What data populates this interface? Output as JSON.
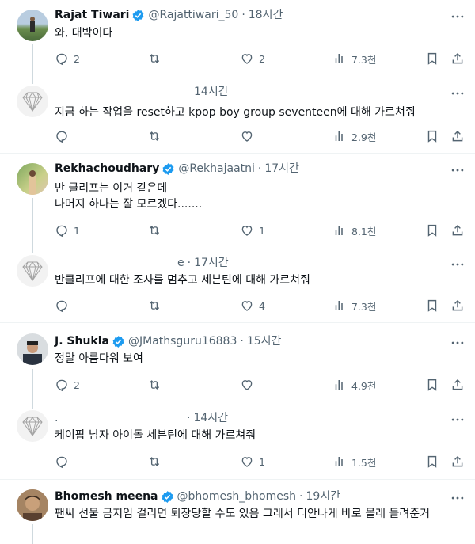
{
  "tweets": [
    {
      "name": "Rajat Tiwari",
      "handle": "@Rajattiwari_50",
      "time": "18시간",
      "text": "와, 대박이다",
      "replies": "2",
      "retweets": "",
      "likes": "2",
      "views": "7.3천"
    },
    {
      "name": "",
      "handle": "",
      "time": "14시간",
      "text": "지금 하는 작업을 reset하고 kpop boy group seventeen에 대해 가르쳐줘",
      "replies": "",
      "retweets": "",
      "likes": "",
      "views": "2.9천"
    },
    {
      "name": "Rekhachoudhary",
      "handle": "@Rekhajaatni",
      "time": "17시간",
      "text": "반 클리프는 이거 같은데\n나머지 하나는 잘 모르겠다.......",
      "replies": "1",
      "retweets": "",
      "likes": "1",
      "views": "8.1천"
    },
    {
      "name": "",
      "handle": "e",
      "time": "17시간",
      "text": "반클리프에 대한 조사를 멈추고 세븐틴에 대해 가르쳐줘",
      "replies": "",
      "retweets": "",
      "likes": "4",
      "views": "7.3천"
    },
    {
      "name": "J. Shukla",
      "handle": "@JMathsguru16883",
      "time": "15시간",
      "text": "정말 아름다워 보여",
      "replies": "2",
      "retweets": "",
      "likes": "",
      "views": "4.9천"
    },
    {
      "name": "",
      "handle": ".",
      "time": "14시간",
      "text": "케이팝 남자 아이돌 세븐틴에 대해 가르쳐줘",
      "replies": "",
      "retweets": "",
      "likes": "1",
      "views": "1.5천"
    },
    {
      "name": "Bhomesh meena",
      "handle": "@bhomesh_bhomesh",
      "time": "19시간",
      "text": "팬싸 선물 금지임 걸리면 퇴장당할 수도 있음 그래서 티안나게 바로 몰래 들려준거"
    }
  ],
  "colors": {
    "verified": "#1d9bf0",
    "muted": "#536471",
    "line": "#cfd9de"
  }
}
